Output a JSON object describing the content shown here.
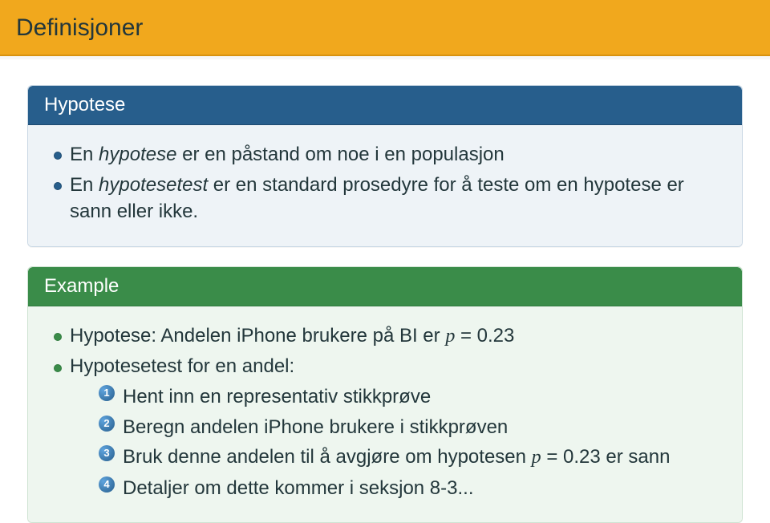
{
  "slide": {
    "title": "Definisjoner"
  },
  "block1": {
    "title": "Hypotese",
    "items": [
      {
        "pre": "En ",
        "em": "hypotese",
        "post": " er en påstand om noe i en populasjon"
      },
      {
        "pre": "En ",
        "em": "hypotesetest",
        "post": " er en standard prosedyre for å teste om en hypotese er sann eller ikke."
      }
    ]
  },
  "block2": {
    "title": "Example",
    "items": [
      {
        "text": "Hypotese: Andelen iPhone brukere på BI er ",
        "var": "p",
        "eq": " = 0.23"
      },
      {
        "text": "Hypotesetest for en andel:"
      }
    ],
    "enum": [
      "Hent inn en representativ stikkprøve",
      "Beregn andelen iPhone brukere i stikkprøven",
      {
        "pre": "Bruk denne andelen til å avgjøre om hypotesen ",
        "var": "p",
        "eq": " = 0.23",
        "post": " er sann"
      },
      "Detaljer om dette kommer i seksjon 8-3..."
    ]
  }
}
